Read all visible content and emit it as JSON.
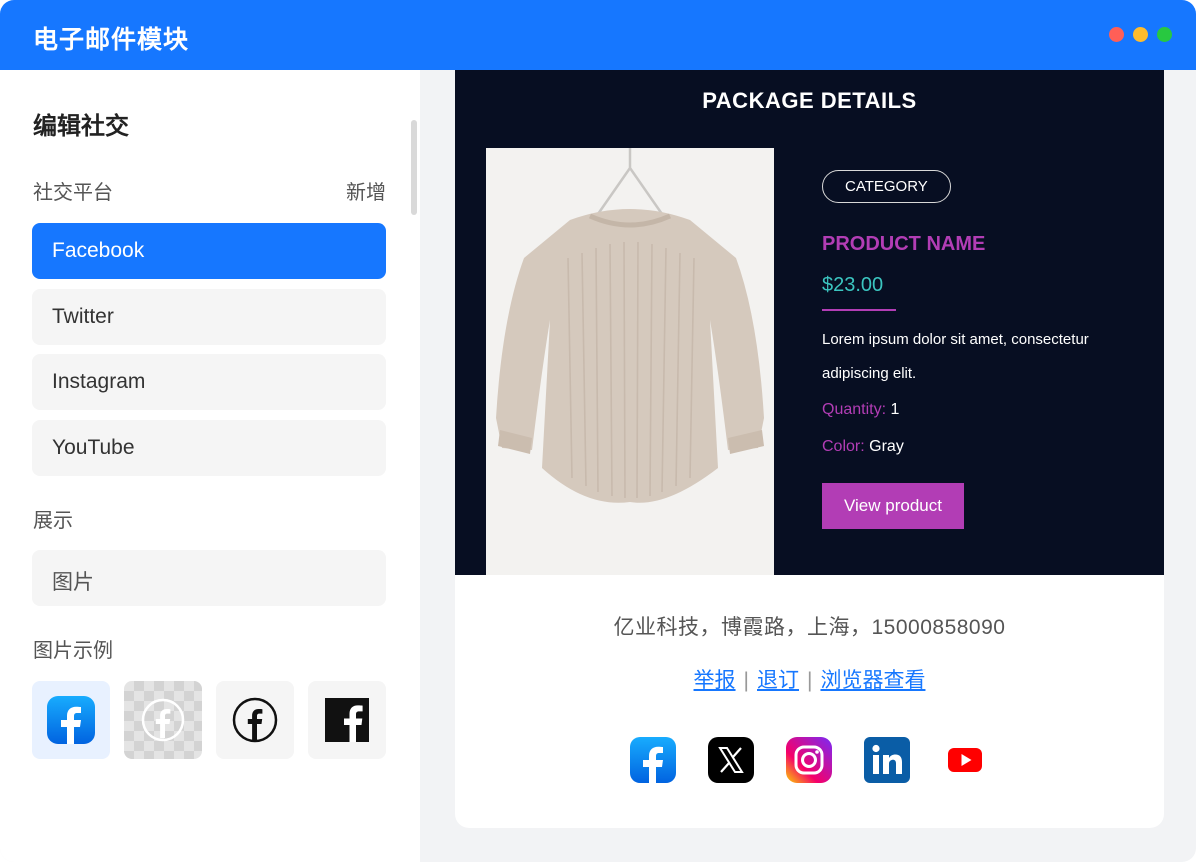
{
  "window": {
    "title": "电子邮件模块",
    "dot_colors": [
      "#ff5f57",
      "#febc2e",
      "#28c840"
    ]
  },
  "sidebar": {
    "heading": "编辑社交",
    "platforms_label": "社交平台",
    "add_label": "新增",
    "platforms": [
      {
        "label": "Facebook",
        "active": true
      },
      {
        "label": "Twitter",
        "active": false
      },
      {
        "label": "Instagram",
        "active": false
      },
      {
        "label": "YouTube",
        "active": false
      }
    ],
    "display_label": "展示",
    "display_value": "图片",
    "examples_label": "图片示例",
    "example_icons": [
      "facebook-gradient-icon",
      "facebook-faded-icon",
      "facebook-circle-outline-icon",
      "facebook-square-black-icon"
    ]
  },
  "preview": {
    "section_title": "PACKAGE DETAILS",
    "category": "CATEGORY",
    "product_name": "PRODUCT NAME",
    "price": "$23.00",
    "description": "Lorem ipsum dolor sit amet, consectetur adipiscing elit.",
    "quantity_label": "Quantity:",
    "quantity_value": "1",
    "color_label": "Color:",
    "color_value": "Gray",
    "button_label": "View product",
    "accent_color": "#b23db5",
    "price_color": "#3bc5c0",
    "background_color": "#070e22"
  },
  "footer": {
    "address": "亿业科技，博霞路，上海，15000858090",
    "links": [
      "举报",
      "退订",
      "浏览器查看"
    ],
    "separator": "|",
    "social_icons": [
      "facebook-icon",
      "x-icon",
      "instagram-icon",
      "linkedin-icon",
      "youtube-icon"
    ]
  }
}
